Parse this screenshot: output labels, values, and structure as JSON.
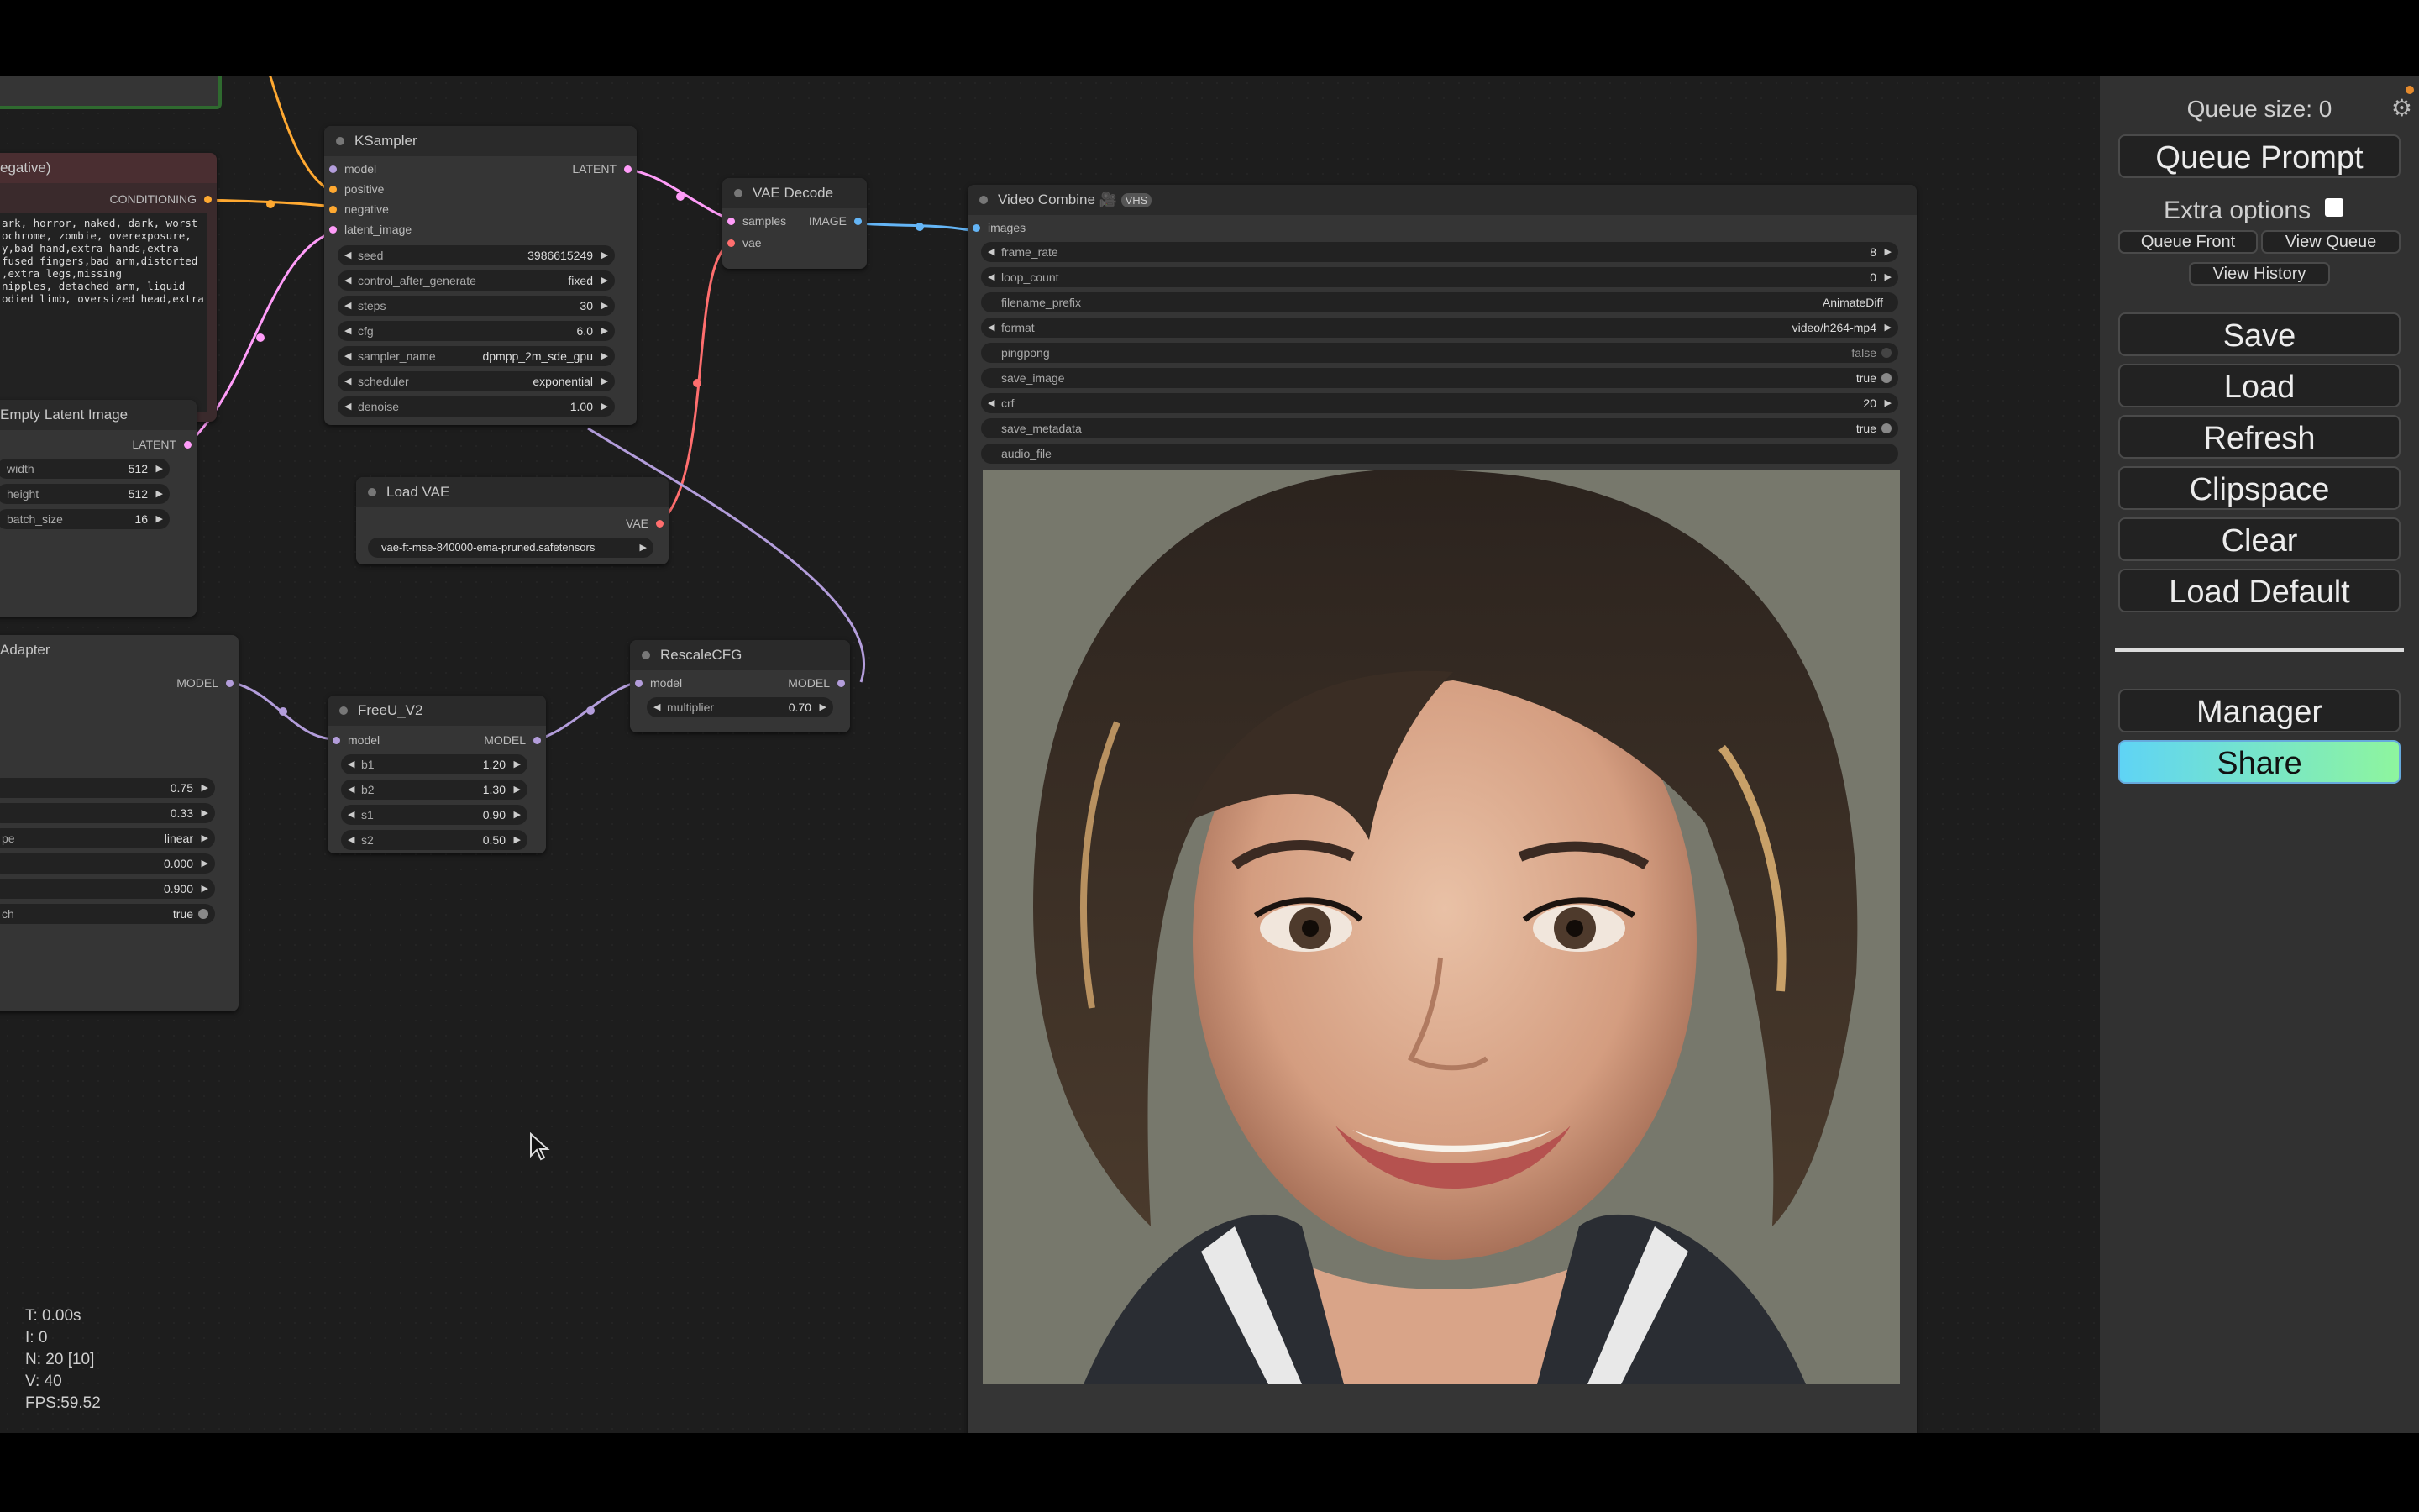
{
  "nodes": {
    "negative": {
      "title": "egative)",
      "output": "CONDITIONING",
      "text": [
        "ark, horror, naked, dark, worst",
        "ochrome, zombie, overexposure,",
        "y,bad hand,extra hands,extra",
        "fused fingers,bad arm,distorted",
        ",extra legs,missing",
        "nipples, detached arm, liquid",
        "odied limb, oversized head,extra"
      ]
    },
    "ksampler": {
      "title": "KSampler",
      "inputs": [
        "model",
        "positive",
        "negative",
        "latent_image"
      ],
      "output": "LATENT",
      "widgets": [
        {
          "label": "seed",
          "value": "3986615249"
        },
        {
          "label": "control_after_generate",
          "value": "fixed"
        },
        {
          "label": "steps",
          "value": "30"
        },
        {
          "label": "cfg",
          "value": "6.0"
        },
        {
          "label": "sampler_name",
          "value": "dpmpp_2m_sde_gpu"
        },
        {
          "label": "scheduler",
          "value": "exponential"
        },
        {
          "label": "denoise",
          "value": "1.00"
        }
      ]
    },
    "vae_decode": {
      "title": "VAE Decode",
      "inputs": [
        "samples",
        "vae"
      ],
      "output": "IMAGE"
    },
    "empty_latent": {
      "title": "Empty Latent Image",
      "output": "LATENT",
      "widgets": [
        {
          "label": "width",
          "value": "512"
        },
        {
          "label": "height",
          "value": "512"
        },
        {
          "label": "batch_size",
          "value": "16"
        }
      ]
    },
    "load_vae": {
      "title": "Load VAE",
      "output": "VAE",
      "file": "vae-ft-mse-840000-ema-pruned.safetensors"
    },
    "adapter": {
      "title": "Adapter",
      "output": "MODEL",
      "widgets": [
        {
          "label": "",
          "value": "0.75"
        },
        {
          "label": "",
          "value": "0.33"
        },
        {
          "label": "pe",
          "value": "linear"
        },
        {
          "label": "",
          "value": "0.000"
        },
        {
          "label": "",
          "value": "0.900"
        },
        {
          "label": "ch",
          "value": "true"
        }
      ]
    },
    "freeu": {
      "title": "FreeU_V2",
      "input": "model",
      "output": "MODEL",
      "widgets": [
        {
          "label": "b1",
          "value": "1.20"
        },
        {
          "label": "b2",
          "value": "1.30"
        },
        {
          "label": "s1",
          "value": "0.90"
        },
        {
          "label": "s2",
          "value": "0.50"
        }
      ]
    },
    "rescale": {
      "title": "RescaleCFG",
      "input": "model",
      "output": "MODEL",
      "widgets": [
        {
          "label": "multiplier",
          "value": "0.70"
        }
      ]
    },
    "video_combine": {
      "title": "Video Combine 🎥",
      "badge": "VHS",
      "input": "images",
      "widgets": [
        {
          "label": "frame_rate",
          "value": "8"
        },
        {
          "label": "loop_count",
          "value": "0"
        },
        {
          "label": "filename_prefix",
          "value": "AnimateDiff"
        },
        {
          "label": "format",
          "value": "video/h264-mp4"
        },
        {
          "label": "pingpong",
          "value": "false"
        },
        {
          "label": "save_image",
          "value": "true"
        },
        {
          "label": "crf",
          "value": "20"
        },
        {
          "label": "save_metadata",
          "value": "true"
        },
        {
          "label": "audio_file",
          "value": ""
        }
      ]
    }
  },
  "stats": {
    "t": "T: 0.00s",
    "i": "I: 0",
    "n": "N: 20 [10]",
    "v": "V: 40",
    "fps": "FPS:59.52"
  },
  "panel": {
    "queue_size": "Queue size: 0",
    "queue_prompt": "Queue Prompt",
    "extra_options": "Extra options",
    "queue_front": "Queue Front",
    "view_queue": "View Queue",
    "view_history": "View History",
    "save": "Save",
    "load": "Load",
    "refresh": "Refresh",
    "clipspace": "Clipspace",
    "clear": "Clear",
    "load_default": "Load Default",
    "manager": "Manager",
    "share": "Share"
  },
  "colors": {
    "model": "#b39ddb",
    "conditioning": "#ffa931",
    "latent": "#ff9cf9",
    "image": "#64b5f6",
    "vae": "#ff6e6e",
    "share_gradient": [
      "#5fd4f5",
      "#8ef59e"
    ]
  }
}
